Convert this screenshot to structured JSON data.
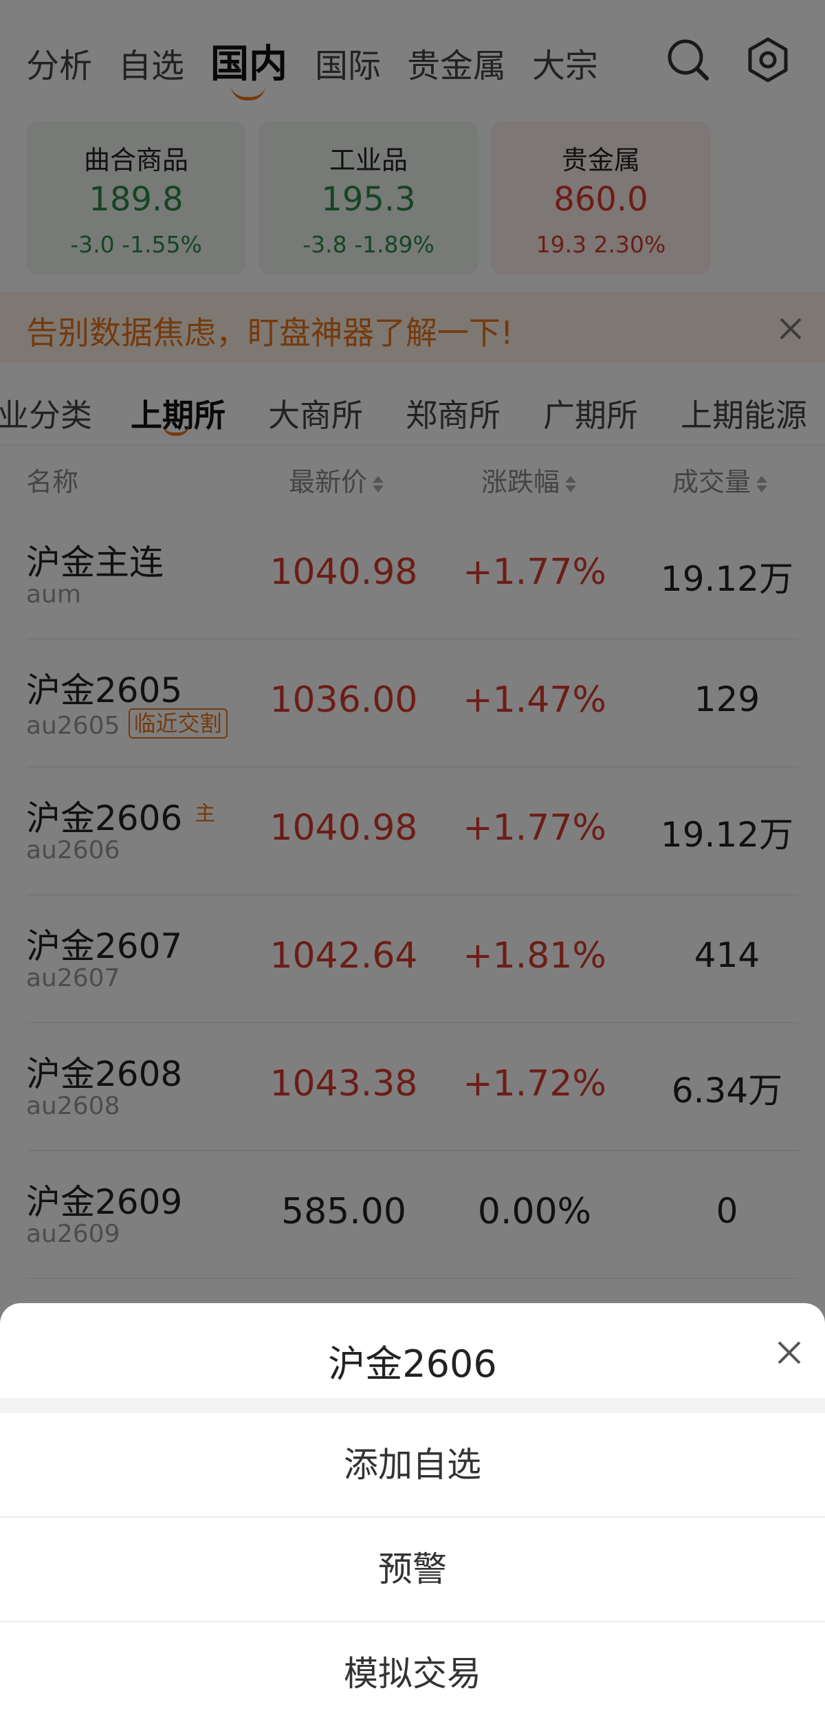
{
  "nav": {
    "tabs": [
      "分析",
      "自选",
      "国内",
      "国际",
      "贵金属",
      "大宗"
    ],
    "active": "国内"
  },
  "cards": [
    {
      "name": "曲合商品",
      "price": "189.8",
      "change": "-3.0  -1.55%",
      "color": "#2a8a48"
    },
    {
      "name": "工业品",
      "price": "195.3",
      "change": "-3.8  -1.89%",
      "color": "#2a8a48"
    },
    {
      "name": "贵金属",
      "price": "860.0",
      "change": "19.3  2.30%",
      "color": "#d93a2b"
    }
  ],
  "banner": {
    "text": "告别数据焦虑，盯盘神器了解一下!"
  },
  "exchange_tabs": [
    "业分类",
    "上期所",
    "大商所",
    "郑商所",
    "广期所",
    "上期能源"
  ],
  "exchange_active": "上期所",
  "table": {
    "headers": {
      "name": "名称",
      "price": "最新价",
      "change": "涨跌幅",
      "volume": "成交量"
    },
    "rows": [
      {
        "name": "沪金主连",
        "code": "aum",
        "tag": "",
        "main": "",
        "price": "1040.98",
        "change": "+1.77%",
        "volume": "19.12万",
        "trend": "up"
      },
      {
        "name": "沪金2605",
        "code": "au2605",
        "tag": "临近交割",
        "main": "",
        "price": "1036.00",
        "change": "+1.47%",
        "volume": "129",
        "trend": "up"
      },
      {
        "name": "沪金2606",
        "code": "au2606",
        "tag": "",
        "main": "主",
        "price": "1040.98",
        "change": "+1.77%",
        "volume": "19.12万",
        "trend": "up"
      },
      {
        "name": "沪金2607",
        "code": "au2607",
        "tag": "",
        "main": "",
        "price": "1042.64",
        "change": "+1.81%",
        "volume": "414",
        "trend": "up"
      },
      {
        "name": "沪金2608",
        "code": "au2608",
        "tag": "",
        "main": "",
        "price": "1043.38",
        "change": "+1.72%",
        "volume": "6.34万",
        "trend": "up"
      },
      {
        "name": "沪金2609",
        "code": "au2609",
        "tag": "",
        "main": "",
        "price": "585.00",
        "change": "0.00%",
        "volume": "0",
        "trend": "flat"
      }
    ]
  },
  "sheet": {
    "title": "沪金2606",
    "items": [
      "添加自选",
      "预警",
      "模拟交易"
    ]
  },
  "colors": {
    "accent": "#e8741a",
    "up": "#d93a2b",
    "down": "#2a8a48"
  },
  "icons": [
    "search-icon",
    "settings-icon",
    "close-icon",
    "sort-icon"
  ]
}
